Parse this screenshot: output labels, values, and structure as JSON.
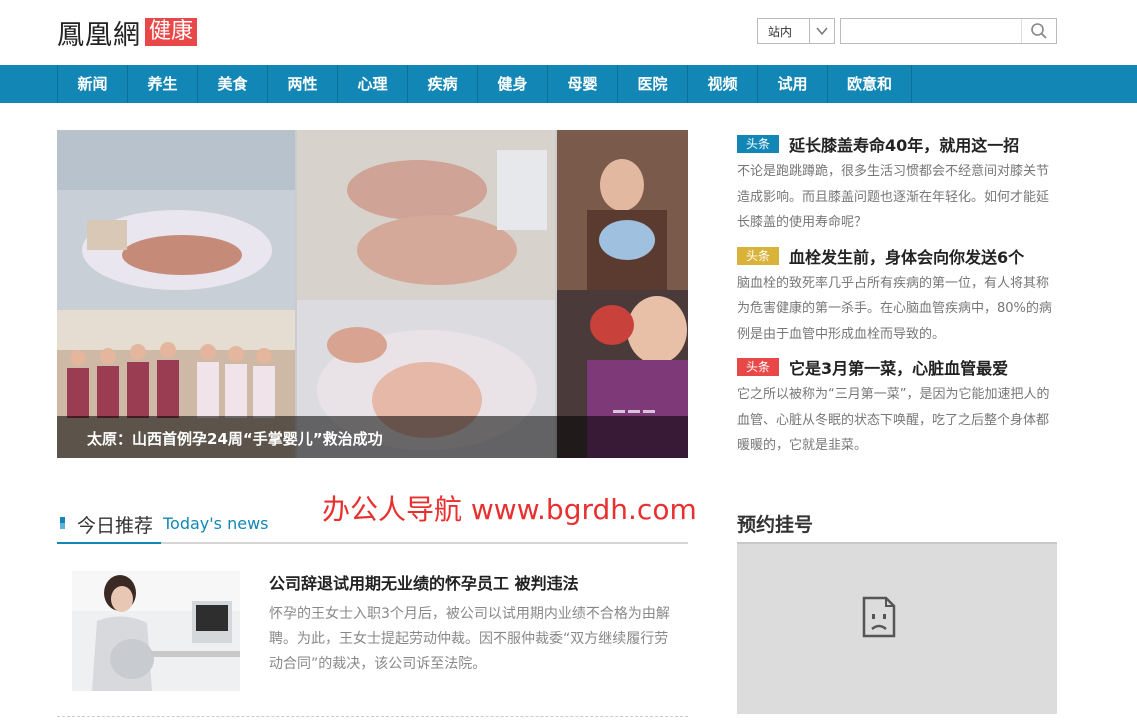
{
  "header": {
    "logo_main": "鳳凰網",
    "logo_sub": "健康",
    "search_scope": "站内",
    "search_placeholder": ""
  },
  "nav": {
    "items": [
      "新闻",
      "养生",
      "美食",
      "两性",
      "心理",
      "疾病",
      "健身",
      "母婴",
      "医院",
      "视频",
      "试用",
      "欧意和"
    ]
  },
  "hero": {
    "caption": "太原：山西首例孕24周“手掌婴儿”救治成功"
  },
  "side_news": [
    {
      "tag": "头条",
      "tag_color": "#1287b5",
      "title": "延长膝盖寿命40年，就用这一招",
      "desc": "不论是跑跳蹲跪，很多生活习惯都会不经意间对膝关节造成影响。而且膝盖问题也逐渐在年轻化。如何才能延长膝盖的使用寿命呢？"
    },
    {
      "tag": "头条",
      "tag_color": "#d9b23a",
      "title": "血栓发生前，身体会向你发送6个",
      "desc": "脑血栓的致死率几乎占所有疾病的第一位，有人将其称为危害健康的第一杀手。在心脑血管疾病中，80%的病例是由于血管中形成血栓而导致的。"
    },
    {
      "tag": "头条",
      "tag_color": "#e84848",
      "title": "它是3月第一菜，心脏血管最爱",
      "desc": "它之所以被称为“三月第一菜”，是因为它能加速把人的血管、心脏从冬眠的状态下唤醒，吃了之后整个身体都暖暖的，它就是韭菜。"
    }
  ],
  "section": {
    "title": "今日推荐",
    "subtitle": "Today's news"
  },
  "watermark": "办公人导航 www.bgrdh.com",
  "article": {
    "title": "公司辞退试用期无业绩的怀孕员工 被判违法",
    "desc": "怀孕的王女士入职3个月后，被公司以试用期内业绩不合格为由解聘。为此，王女士提起劳动仲裁。因不服仲裁委“双方继续履行劳动合同”的裁决，该公司诉至法院。"
  },
  "booking": {
    "title": "预约挂号"
  }
}
